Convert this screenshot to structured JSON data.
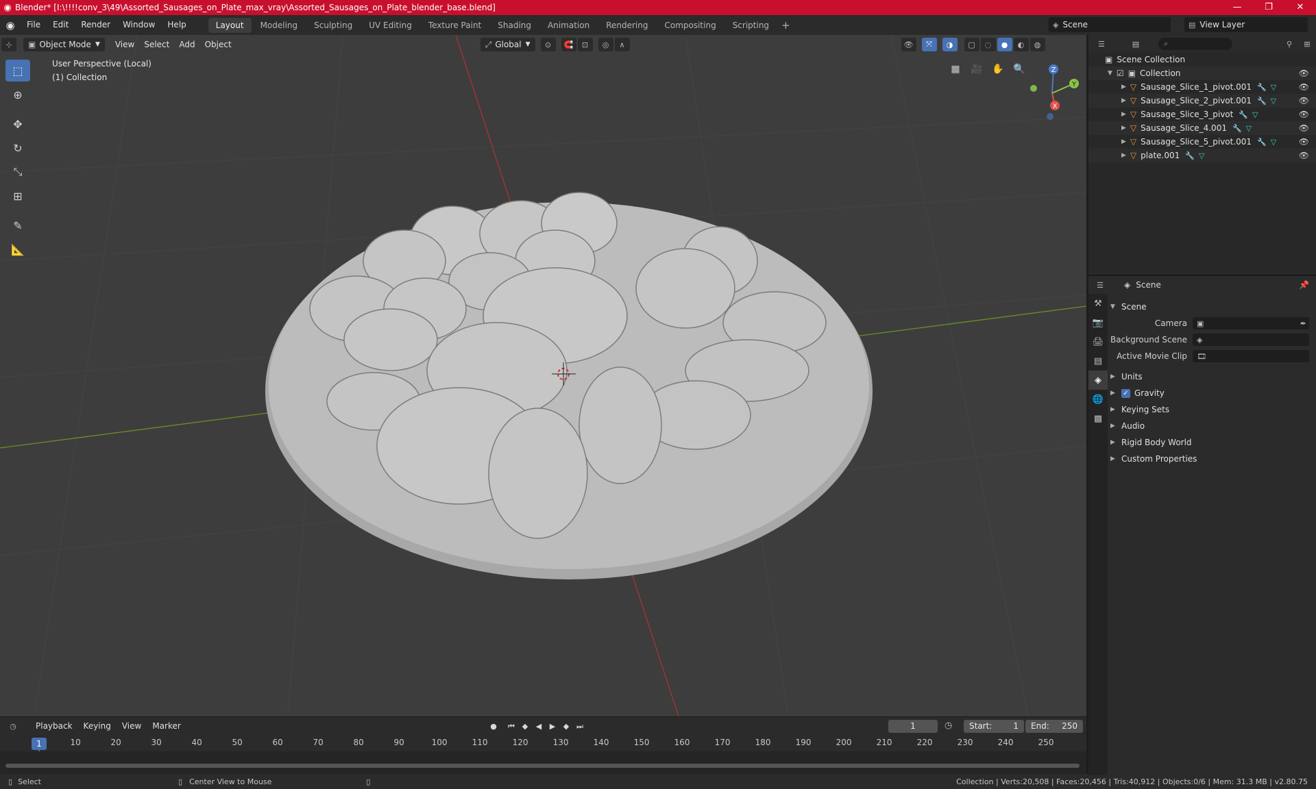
{
  "titlebar": {
    "title": "Blender* [I:\\!!!!conv_3\\49\\Assorted_Sausages_on_Plate_max_vray\\Assorted_Sausages_on_Plate_blender_base.blend]",
    "minimize": "—",
    "maximize": "❐",
    "close": "✕"
  },
  "menubar": {
    "items": [
      "File",
      "Edit",
      "Render",
      "Window",
      "Help"
    ],
    "workspaces": [
      "Layout",
      "Modeling",
      "Sculpting",
      "UV Editing",
      "Texture Paint",
      "Shading",
      "Animation",
      "Rendering",
      "Compositing",
      "Scripting"
    ],
    "active_workspace": "Layout",
    "add_workspace": "+",
    "scene": "Scene",
    "view_layer": "View Layer"
  },
  "viewport": {
    "mode": "Object Mode",
    "menus": [
      "View",
      "Select",
      "Add",
      "Object"
    ],
    "transform_orientation": "Global",
    "info_line1": "User Perspective (Local)",
    "info_line2": "(1) Collection",
    "gizmo": {
      "z": "Z",
      "y": "Y",
      "x": "X"
    }
  },
  "toolbar": {
    "tools": [
      "select-box",
      "cursor",
      "move",
      "rotate",
      "scale",
      "transform",
      "annotate",
      "measure"
    ],
    "active": "select-box"
  },
  "timeline": {
    "menus": [
      "Playback",
      "Keying",
      "View",
      "Marker"
    ],
    "current_frame": "1",
    "start_label": "Start:",
    "start_value": "1",
    "end_label": "End:",
    "end_value": "250",
    "ticks": [
      "10",
      "20",
      "30",
      "40",
      "50",
      "60",
      "70",
      "80",
      "90",
      "100",
      "110",
      "120",
      "130",
      "140",
      "150",
      "160",
      "170",
      "180",
      "190",
      "200",
      "210",
      "220",
      "230",
      "240",
      "250"
    ],
    "cursor_frame": "1"
  },
  "statusbar": {
    "left_action": "Select",
    "middle_action": "Center View to Mouse",
    "stats": "Collection | Verts:20,508 | Faces:20,456 | Tris:40,912 | Objects:0/6 | Mem: 31.3 MB | v2.80.75"
  },
  "outliner": {
    "search_placeholder": "",
    "scene_collection": "Scene Collection",
    "collection": "Collection",
    "objects": [
      {
        "name": "Sausage_Slice_1_pivot.001"
      },
      {
        "name": "Sausage_Slice_2_pivot.001"
      },
      {
        "name": "Sausage_Slice_3_pivot"
      },
      {
        "name": "Sausage_Slice_4.001"
      },
      {
        "name": "Sausage_Slice_5_pivot.001"
      },
      {
        "name": "plate.001"
      }
    ]
  },
  "properties": {
    "context": "Scene",
    "panel_title": "Scene",
    "camera_label": "Camera",
    "background_scene_label": "Background Scene",
    "active_movie_clip_label": "Active Movie Clip",
    "panels": [
      "Units",
      "Gravity",
      "Keying Sets",
      "Audio",
      "Rigid Body World",
      "Custom Properties"
    ],
    "gravity_checked": true
  }
}
